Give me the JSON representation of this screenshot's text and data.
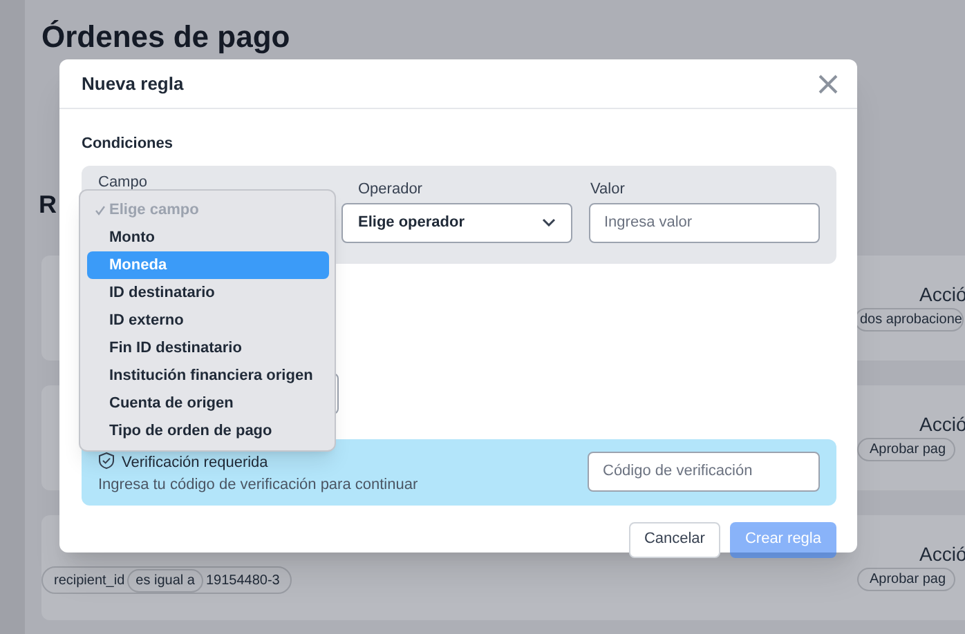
{
  "page": {
    "title": "Órdenes de pago",
    "section_heading": "R",
    "cards": [
      {
        "action_heading": "Acció",
        "action_chip": "dos aprobacione"
      },
      {
        "action_heading": "Acció",
        "action_chip": "Aprobar pag"
      },
      {
        "action_heading": "Acció",
        "action_chip": "Aprobar pag",
        "condition": {
          "field": "recipient_id",
          "operator": "es igual a",
          "value": "19154480-3"
        }
      }
    ]
  },
  "modal": {
    "title": "Nueva regla",
    "section": "Condiciones",
    "columns": [
      "Campo",
      "Operador",
      "Valor"
    ],
    "operator_select": "Elige operador",
    "value_placeholder": "Ingresa valor",
    "verification": {
      "title": "Verificación requerida",
      "message": "Ingresa tu código de verificación para continuar",
      "placeholder": "Código de verificación"
    },
    "buttons": [
      {
        "label": "Cancelar",
        "kind": "secondary",
        "disabled": false
      },
      {
        "label": "Crear regla",
        "kind": "primary",
        "disabled": true
      }
    ]
  },
  "dropdown": {
    "options": [
      {
        "label": "Elige campo",
        "checked": true,
        "disabled": true,
        "selected": false
      },
      {
        "label": "Monto",
        "checked": false,
        "disabled": false,
        "selected": false
      },
      {
        "label": "Moneda",
        "checked": false,
        "disabled": false,
        "selected": true
      },
      {
        "label": "ID destinatario",
        "checked": false,
        "disabled": false,
        "selected": false
      },
      {
        "label": "ID externo",
        "checked": false,
        "disabled": false,
        "selected": false
      },
      {
        "label": "Fin ID destinatario",
        "checked": false,
        "disabled": false,
        "selected": false
      },
      {
        "label": "Institución financiera origen",
        "checked": false,
        "disabled": false,
        "selected": false
      },
      {
        "label": "Cuenta de origen",
        "checked": false,
        "disabled": false,
        "selected": false
      },
      {
        "label": "Tipo de orden de pago",
        "checked": false,
        "disabled": false,
        "selected": false
      }
    ]
  }
}
